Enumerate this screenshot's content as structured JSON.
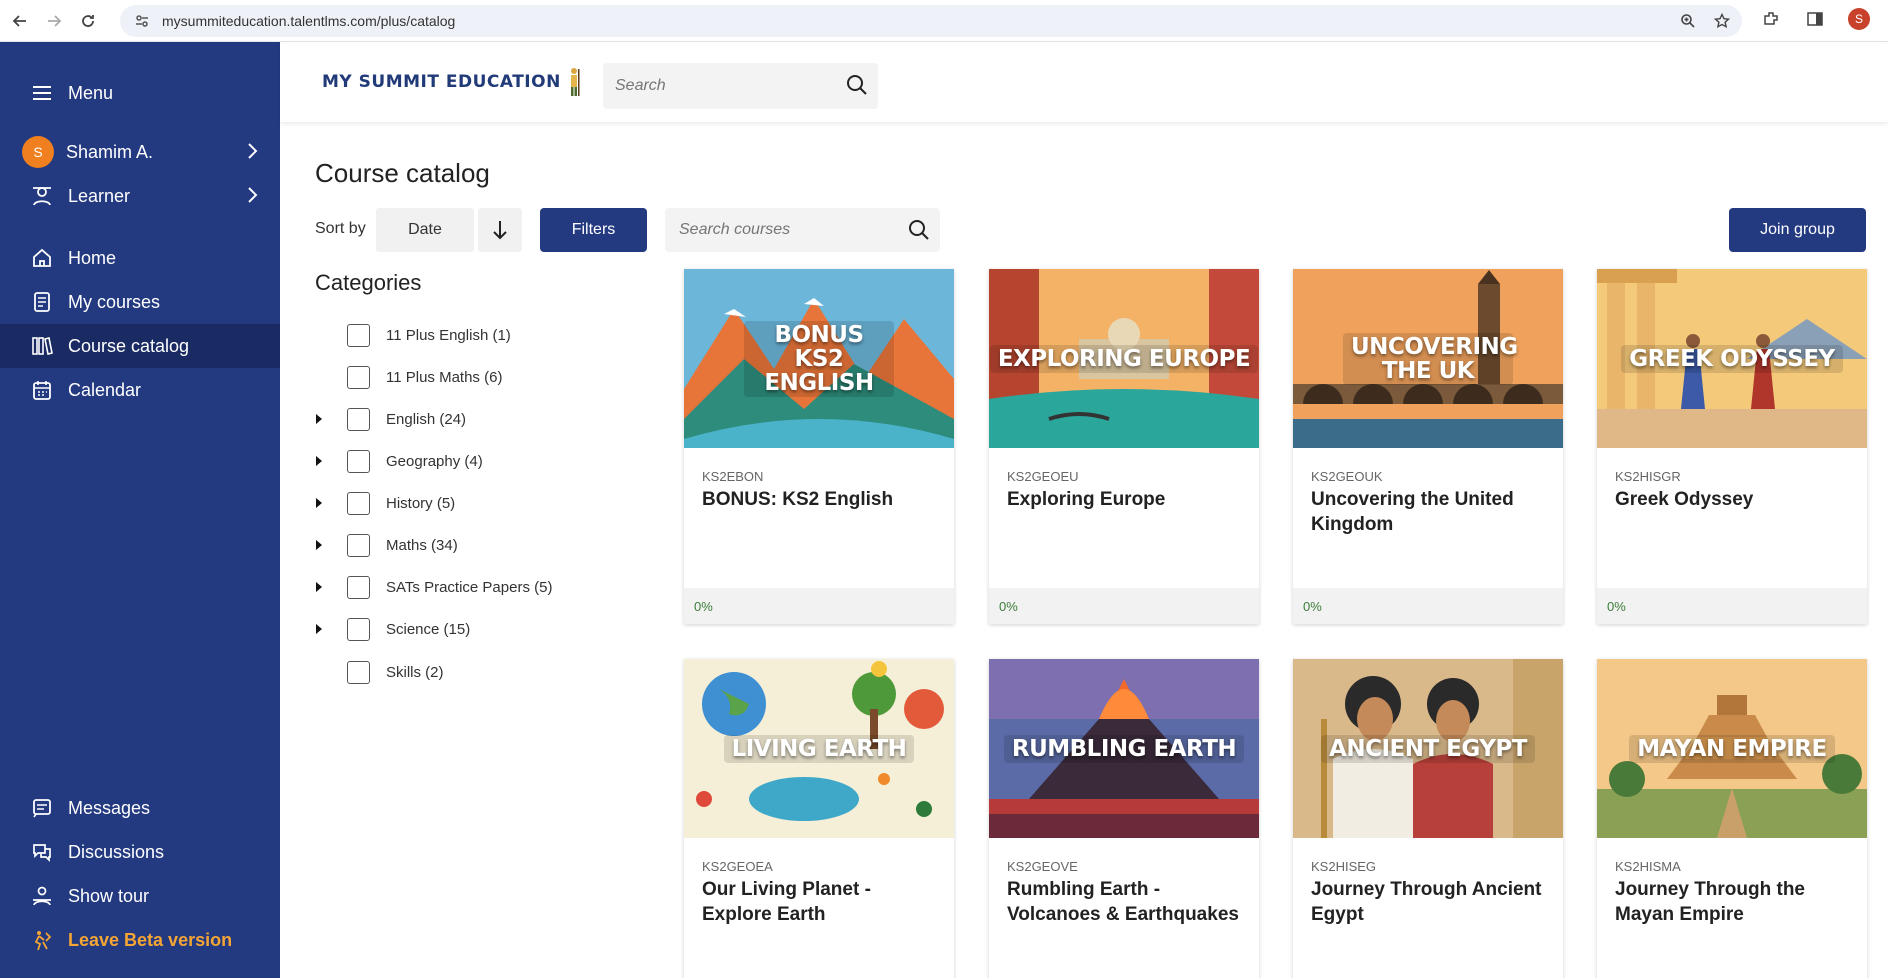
{
  "browser": {
    "url": "mysummiteducation.talentlms.com/plus/catalog",
    "profile_initial": "S"
  },
  "sidebar": {
    "menu_label": "Menu",
    "user_name": "Shamim A.",
    "user_initial": "S",
    "role_label": "Learner",
    "items": [
      {
        "label": "Home",
        "icon": "home-icon"
      },
      {
        "label": "My courses",
        "icon": "book-icon"
      },
      {
        "label": "Course catalog",
        "icon": "library-icon"
      },
      {
        "label": "Calendar",
        "icon": "calendar-icon"
      }
    ],
    "bottom_items": [
      {
        "label": "Messages",
        "icon": "message-icon"
      },
      {
        "label": "Discussions",
        "icon": "discussion-icon"
      },
      {
        "label": "Show tour",
        "icon": "tour-icon"
      },
      {
        "label": "Leave Beta version",
        "icon": "leave-icon"
      }
    ],
    "colors": {
      "background": "#233980",
      "active": "#1a2b63",
      "accent": "#f4a534"
    }
  },
  "header": {
    "logo_text": "MY SUMMIT EDUCATION",
    "search_placeholder": "Search"
  },
  "main": {
    "title": "Course catalog",
    "sort_label": "Sort by",
    "sort_value": "Date",
    "filters_label": "Filters",
    "course_search_placeholder": "Search courses",
    "join_group_label": "Join group",
    "categories_title": "Categories",
    "categories": [
      {
        "label": "11 Plus English (1)",
        "expandable": false
      },
      {
        "label": "11 Plus Maths (6)",
        "expandable": false
      },
      {
        "label": "English (24)",
        "expandable": true
      },
      {
        "label": "Geography (4)",
        "expandable": true
      },
      {
        "label": "History (5)",
        "expandable": true
      },
      {
        "label": "Maths (34)",
        "expandable": true
      },
      {
        "label": "SATs Practice Papers (5)",
        "expandable": true
      },
      {
        "label": "Science (15)",
        "expandable": true
      },
      {
        "label": "Skills (2)",
        "expandable": false
      }
    ],
    "courses": [
      {
        "banner": "BONUS KS2 ENGLISH",
        "code": "KS2EBON",
        "title": "BONUS: KS2 English",
        "progress": "0%"
      },
      {
        "banner": "EXPLORING EUROPE",
        "code": "KS2GEOEU",
        "title": "Exploring Europe",
        "progress": "0%"
      },
      {
        "banner": "UNCOVERING THE UK",
        "code": "KS2GEOUK",
        "title": "Uncovering the United Kingdom",
        "progress": "0%"
      },
      {
        "banner": "GREEK ODYSSEY",
        "code": "KS2HISGR",
        "title": "Greek Odyssey",
        "progress": "0%"
      },
      {
        "banner": "LIVING EARTH",
        "code": "KS2GEOEA",
        "title": "Our Living Planet - Explore Earth",
        "progress": ""
      },
      {
        "banner": "RUMBLING EARTH",
        "code": "KS2GEOVE",
        "title": "Rumbling Earth - Volcanoes & Earthquakes",
        "progress": ""
      },
      {
        "banner": "ANCIENT EGYPT",
        "code": "KS2HISEG",
        "title": "Journey Through Ancient Egypt",
        "progress": ""
      },
      {
        "banner": "MAYAN EMPIRE",
        "code": "KS2HISMA",
        "title": "Journey Through the Mayan Empire",
        "progress": ""
      }
    ]
  }
}
